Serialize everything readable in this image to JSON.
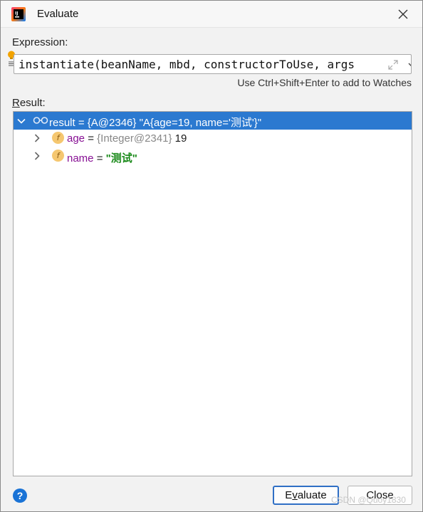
{
  "window": {
    "title": "Evaluate"
  },
  "expression": {
    "label": "Expression:",
    "code_prefix": "instantiate(beanName, mbd, ",
    "code_arg1": "constructorToUse",
    "code_sep": ", ",
    "code_arg2": "args",
    "code_trailing": "᷁",
    "hint": "Use Ctrl+Shift+Enter to add to Watches"
  },
  "result": {
    "label_underlined": "R",
    "label_rest": "esult:",
    "rows": [
      {
        "text": "result = {A@2346} \"A{age=19, name='测试'}\""
      },
      {
        "name": "age",
        "eq": " = ",
        "type": "{Integer@2341}",
        "value": " 19"
      },
      {
        "name": "name",
        "eq": " = ",
        "value": "\"测试\""
      }
    ]
  },
  "buttons": {
    "evaluate_underlined": "v",
    "evaluate_prefix": "E",
    "evaluate_rest": "aluate",
    "close": "Close",
    "help": "?"
  },
  "watermark": "CSDN @Quoy1830",
  "icons": {
    "app": "intellij-idea-icon",
    "close": "close-icon",
    "bulb": "lightbulb-icon",
    "expand": "expand-icon",
    "dropdown": "chevron-down-icon",
    "watch": "glasses-icon",
    "field": "field-icon"
  },
  "colors": {
    "selection": "#2b79d0",
    "field_name": "#871094",
    "string_value": "#1a8a1a",
    "primary_border": "#2f6fc5"
  }
}
